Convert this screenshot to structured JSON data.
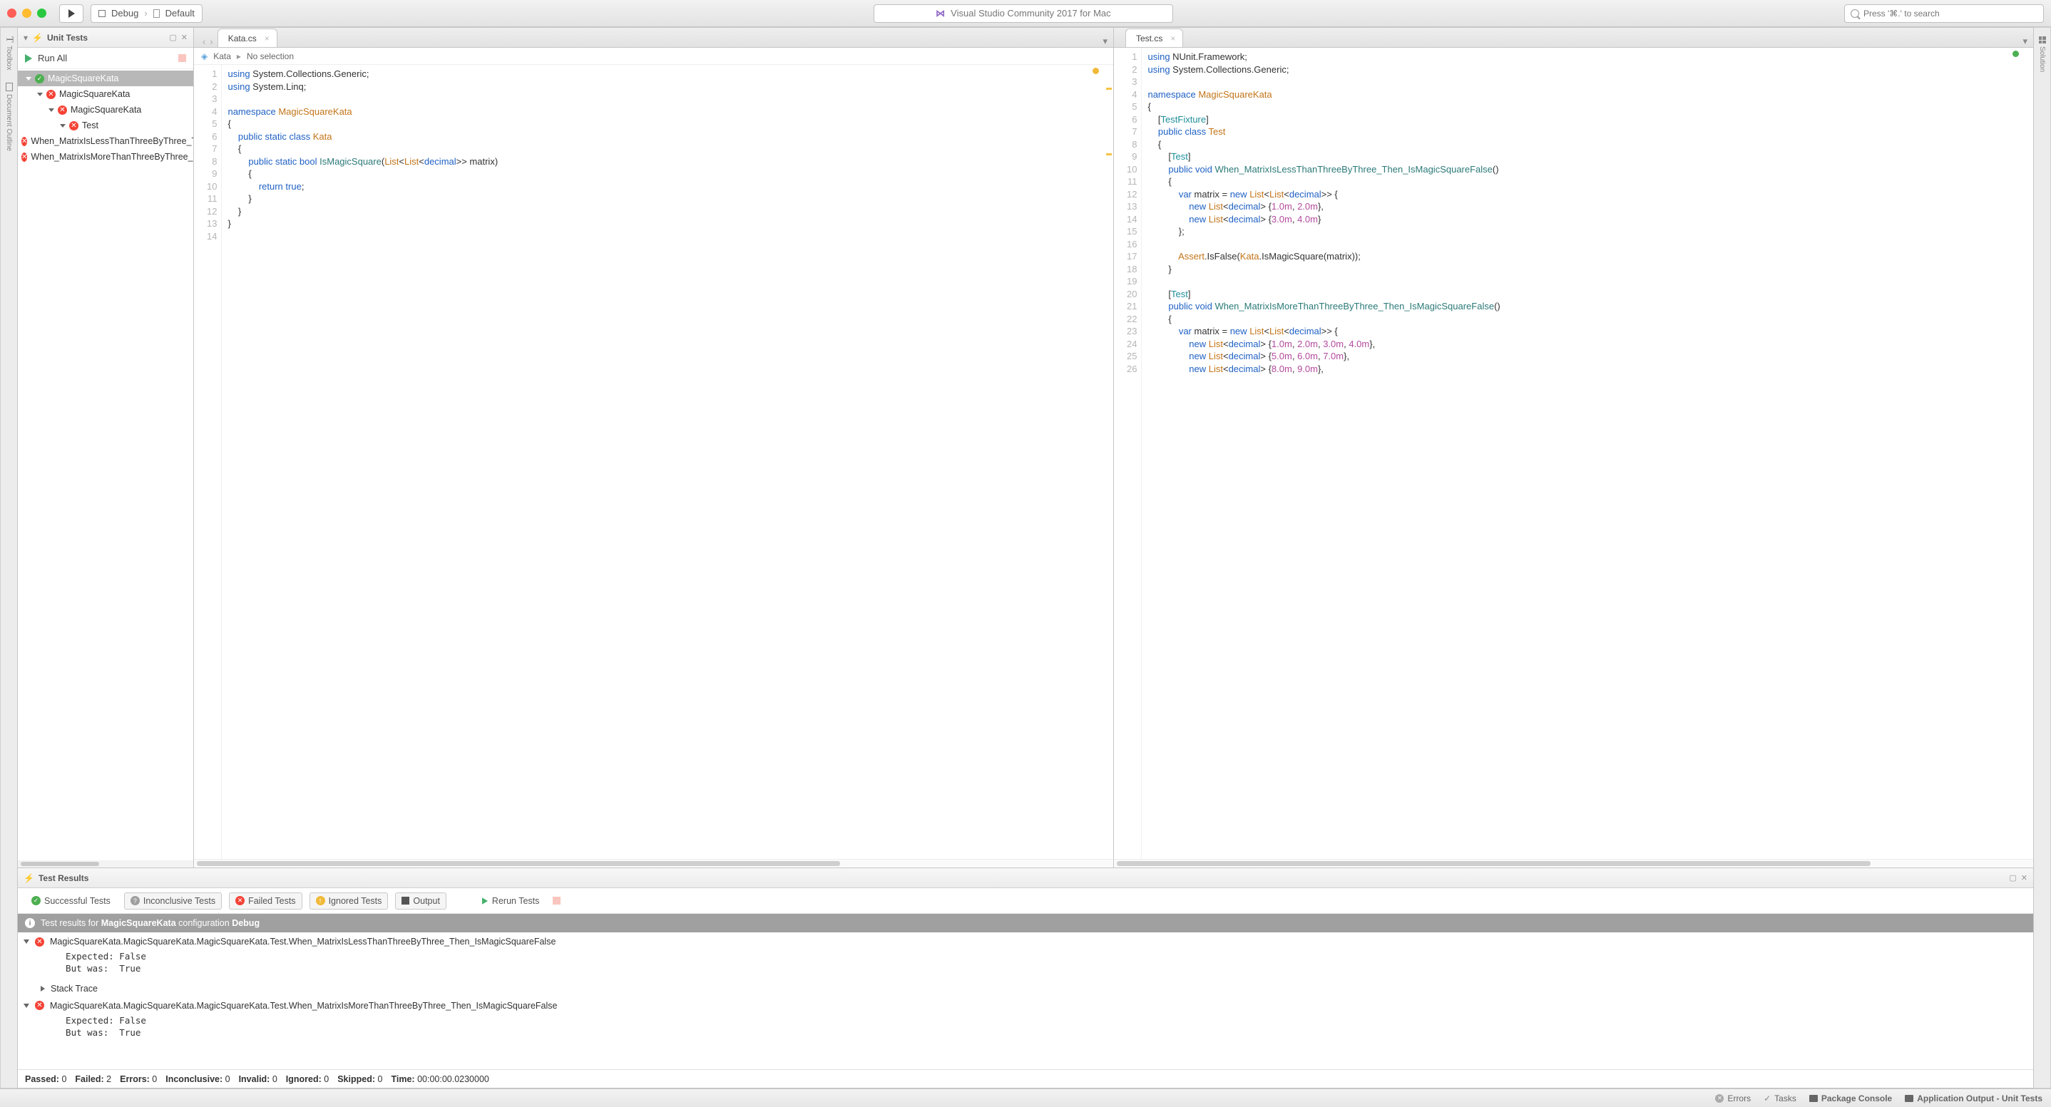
{
  "titlebar": {
    "config_debug": "Debug",
    "config_default": "Default",
    "app_title": "Visual Studio Community 2017 for Mac",
    "search_placeholder": "Press '⌘.' to search"
  },
  "left_rail": {
    "toolbox": "Toolbox",
    "doc_outline": "Document Outline"
  },
  "right_rail": {
    "solution": "Solution"
  },
  "unit_tests_panel": {
    "title": "Unit Tests",
    "run_all": "Run All",
    "tree": {
      "root": "MagicSquareKata",
      "ns": "MagicSquareKata",
      "cls": "MagicSquareKata",
      "test_cls": "Test",
      "t1": "When_MatrixIsLessThanThreeByThree_Then_IsMagicSquareFalse",
      "t2": "When_MatrixIsMoreThanThreeByThree_Then_IsMagicSquareFalse"
    }
  },
  "editor_left": {
    "tab": "Kata.cs",
    "breadcrumb_file": "Kata",
    "breadcrumb_sel": "No selection",
    "code": {
      "line_start": 1,
      "line_end": 14,
      "lines": [
        {
          "html": "<span class='kw'>using</span> System.Collections.Generic;"
        },
        {
          "html": "<span class='kw'>using</span> System.Linq;"
        },
        {
          "html": ""
        },
        {
          "html": "<span class='kw'>namespace</span> <span class='ty'>MagicSquareKata</span>"
        },
        {
          "html": "{"
        },
        {
          "html": "    <span class='kw'>public static class</span> <span class='ty'>Kata</span>"
        },
        {
          "html": "    {"
        },
        {
          "html": "        <span class='kw'>public static</span> <span class='kw'>bool</span> <span class='fn'>IsMagicSquare</span>(<span class='ty'>List</span>&lt;<span class='ty'>List</span>&lt;<span class='kw'>decimal</span>&gt;&gt; matrix)"
        },
        {
          "html": "        {"
        },
        {
          "html": "            <span class='kw'>return</span> <span class='kw'>true</span>;"
        },
        {
          "html": "        }"
        },
        {
          "html": "    }"
        },
        {
          "html": "}"
        },
        {
          "html": ""
        }
      ]
    }
  },
  "editor_right": {
    "tab": "Test.cs",
    "code": {
      "line_start": 1,
      "line_end": 26,
      "lines": [
        {
          "html": "<span class='kw'>using</span> NUnit.Framework;"
        },
        {
          "html": "<span class='kw'>using</span> System.Collections.Generic;"
        },
        {
          "html": ""
        },
        {
          "html": "<span class='kw'>namespace</span> <span class='ty'>MagicSquareKata</span>"
        },
        {
          "html": "{"
        },
        {
          "html": "    [<span class='attr'>TestFixture</span>]"
        },
        {
          "html": "    <span class='kw'>public class</span> <span class='ty'>Test</span>"
        },
        {
          "html": "    {"
        },
        {
          "html": "        [<span class='attr'>Test</span>]"
        },
        {
          "html": "        <span class='kw'>public void</span> <span class='fn'>When_MatrixIsLessThanThreeByThree_Then_IsMagicSquareFalse</span>()"
        },
        {
          "html": "        {"
        },
        {
          "html": "            <span class='kw'>var</span> matrix = <span class='kw'>new</span> <span class='ty'>List</span>&lt;<span class='ty'>List</span>&lt;<span class='kw'>decimal</span>&gt;&gt; {"
        },
        {
          "html": "                <span class='kw'>new</span> <span class='ty'>List</span>&lt;<span class='kw'>decimal</span>&gt; {<span class='num'>1.0m</span>, <span class='num'>2.0m</span>},"
        },
        {
          "html": "                <span class='kw'>new</span> <span class='ty'>List</span>&lt;<span class='kw'>decimal</span>&gt; {<span class='num'>3.0m</span>, <span class='num'>4.0m</span>}"
        },
        {
          "html": "            };"
        },
        {
          "html": ""
        },
        {
          "html": "            <span class='ty'>Assert</span>.IsFalse(<span class='ty'>Kata</span>.IsMagicSquare(matrix));"
        },
        {
          "html": "        }"
        },
        {
          "html": ""
        },
        {
          "html": "        [<span class='attr'>Test</span>]"
        },
        {
          "html": "        <span class='kw'>public void</span> <span class='fn'>When_MatrixIsMoreThanThreeByThree_Then_IsMagicSquareFalse</span>()"
        },
        {
          "html": "        {"
        },
        {
          "html": "            <span class='kw'>var</span> matrix = <span class='kw'>new</span> <span class='ty'>List</span>&lt;<span class='ty'>List</span>&lt;<span class='kw'>decimal</span>&gt;&gt; {"
        },
        {
          "html": "                <span class='kw'>new</span> <span class='ty'>List</span>&lt;<span class='kw'>decimal</span>&gt; {<span class='num'>1.0m</span>, <span class='num'>2.0m</span>, <span class='num'>3.0m</span>, <span class='num'>4.0m</span>},"
        },
        {
          "html": "                <span class='kw'>new</span> <span class='ty'>List</span>&lt;<span class='kw'>decimal</span>&gt; {<span class='num'>5.0m</span>, <span class='num'>6.0m</span>, <span class='num'>7.0m</span>},"
        },
        {
          "html": "                <span class='kw'>new</span> <span class='ty'>List</span>&lt;<span class='kw'>decimal</span>&gt; {<span class='num'>8.0m</span>, <span class='num'>9.0m</span>},"
        }
      ]
    }
  },
  "test_results": {
    "title": "Test Results",
    "filters": {
      "success": "Successful Tests",
      "inconclusive": "Inconclusive Tests",
      "failed": "Failed Tests",
      "ignored": "Ignored Tests",
      "output": "Output",
      "rerun": "Rerun Tests"
    },
    "banner_prefix": "Test results for ",
    "banner_project": "MagicSquareKata",
    "banner_mid": " configuration ",
    "banner_config": "Debug",
    "results": [
      {
        "name": "MagicSquareKata.MagicSquareKata.MagicSquareKata.Test.When_MatrixIsLessThanThreeByThree_Then_IsMagicSquareFalse",
        "detail": "  Expected: False\n  But was:  True",
        "stack": "Stack Trace"
      },
      {
        "name": "MagicSquareKata.MagicSquareKata.MagicSquareKata.Test.When_MatrixIsMoreThanThreeByThree_Then_IsMagicSquareFalse",
        "detail": "  Expected: False\n  But was:  True"
      }
    ],
    "footer": {
      "passed_l": "Passed:",
      "passed_v": "0",
      "failed_l": "Failed:",
      "failed_v": "2",
      "errors_l": "Errors:",
      "errors_v": "0",
      "inconclusive_l": "Inconclusive:",
      "inconclusive_v": "0",
      "invalid_l": "Invalid:",
      "invalid_v": "0",
      "ignored_l": "Ignored:",
      "ignored_v": "0",
      "skipped_l": "Skipped:",
      "skipped_v": "0",
      "time_l": "Time:",
      "time_v": "00:00:00.0230000"
    }
  },
  "statusbar": {
    "errors": "Errors",
    "tasks": "Tasks",
    "pkg": "Package Console",
    "appout": "Application Output - Unit Tests"
  }
}
